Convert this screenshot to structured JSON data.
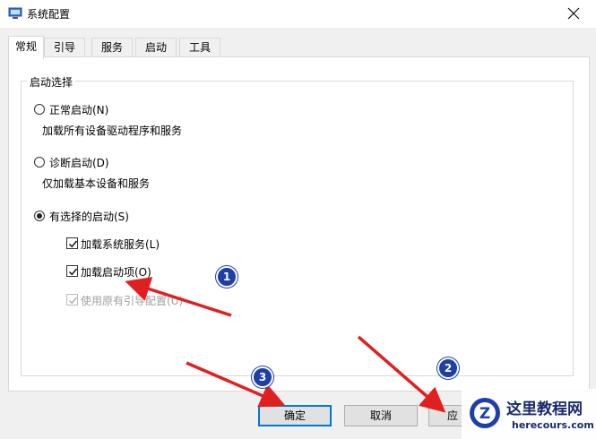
{
  "window": {
    "title": "系统配置"
  },
  "tabs": [
    {
      "label": "常规",
      "active": true
    },
    {
      "label": "引导",
      "active": false
    },
    {
      "label": "服务",
      "active": false
    },
    {
      "label": "启动",
      "active": false
    },
    {
      "label": "工具",
      "active": false
    }
  ],
  "startup_selection": {
    "group_title": "启动选择",
    "normal": {
      "label": "正常启动(N)",
      "desc": "加载所有设备驱动程序和服务",
      "selected": false
    },
    "diagnostic": {
      "label": "诊断启动(D)",
      "desc": "仅加载基本设备和服务",
      "selected": false
    },
    "selective": {
      "label": "有选择的启动(S)",
      "selected": true,
      "options": [
        {
          "label": "加载系统服务(L)",
          "checked": true,
          "enabled": true
        },
        {
          "label": "加载启动项(O)",
          "checked": true,
          "enabled": true
        },
        {
          "label": "使用原有引导配置(U)",
          "checked": true,
          "enabled": false
        }
      ]
    }
  },
  "buttons": {
    "ok": "确定",
    "cancel": "取消",
    "apply": "应"
  },
  "annotations": {
    "badge1": "1",
    "badge2": "2",
    "badge3": "3",
    "color": "#e02020"
  },
  "watermark": {
    "cn": "这里教程网",
    "en": "herecours.com",
    "logo_letter": "Z"
  }
}
